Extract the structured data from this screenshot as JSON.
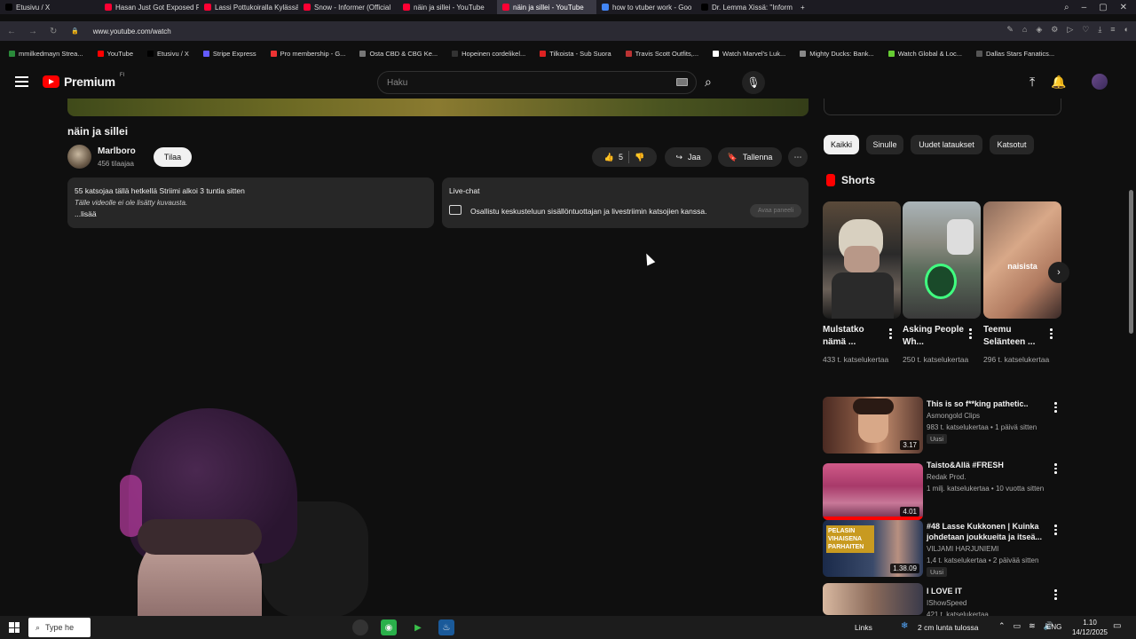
{
  "browser": {
    "tabs": [
      {
        "label": "Etusivu / X",
        "color": "#000000"
      },
      {
        "label": "Hasan Just Got Exposed Fr",
        "color": "#ff0033"
      },
      {
        "label": "Lassi Pottukoiralla Kylässä",
        "color": "#ff0033"
      },
      {
        "label": "Snow - Informer (Official",
        "color": "#ff0033"
      },
      {
        "label": "näin ja sillei - YouTube",
        "color": "#ff0033"
      },
      {
        "label": "näin ja sillei - YouTube",
        "color": "#ff0033",
        "active": true
      },
      {
        "label": "how to vtuber work - Goo",
        "color": "#4285f4"
      },
      {
        "label": "Dr. Lemma Xissä: \"Inform",
        "color": "#000000"
      }
    ],
    "url": "www.youtube.com/watch",
    "bookmarks": [
      {
        "label": "mmilkedmayn Strea...",
        "color": "#2a8a3a"
      },
      {
        "label": "YouTube",
        "color": "#ff0000"
      },
      {
        "label": "Etusivu / X",
        "color": "#000000"
      },
      {
        "label": "Stripe Express",
        "color": "#635bff"
      },
      {
        "label": "Pro membership - G...",
        "color": "#e33"
      },
      {
        "label": "Osta CBD & CBG Ke...",
        "color": "#777"
      },
      {
        "label": "Hopeinen cordelikel...",
        "color": "#333"
      },
      {
        "label": "Tilkoista - Sub Suora",
        "color": "#d22"
      },
      {
        "label": "Travis Scott Outfits,...",
        "color": "#b33"
      },
      {
        "label": "Watch Marvel's Luk...",
        "color": "#fff"
      },
      {
        "label": "Mighty Ducks: Bank...",
        "color": "#888"
      },
      {
        "label": "Watch Global & Loc...",
        "color": "#6c3"
      },
      {
        "label": "Dallas Stars Fanatics...",
        "color": "#555"
      }
    ]
  },
  "header": {
    "logo_text": "Premium",
    "region": "FI",
    "search_placeholder": "Haku"
  },
  "video": {
    "title": "näin ja sillei",
    "channel": "Marlboro",
    "subscribers": "456 tilaajaa",
    "subscribe_label": "Tilaa",
    "likes": "5",
    "share_label": "Jaa",
    "save_label": "Tallenna",
    "description": {
      "stats": "55 katsojaa tällä hetkellä  Striimi alkoi 3 tuntia sitten",
      "empty_note": "Tälle videolle ei ole lisätty kuvausta.",
      "more": "...lisää"
    },
    "live_chat": {
      "title": "Live-chat",
      "text": "Osallistu keskusteluun sisällöntuottajan ja livestriimin katsojien kanssa.",
      "open_label": "Avaa paneeli"
    }
  },
  "sidebar": {
    "chips": [
      "Kaikki",
      "Sinulle",
      "Uudet lataukset",
      "Katsotut"
    ],
    "shorts_heading": "Shorts",
    "shorts": [
      {
        "title": "Mulstatko nämä ...",
        "views": "433 t. katselukertaa"
      },
      {
        "title": "Asking People Wh...",
        "views": "250 t. katselukertaa"
      },
      {
        "title": "Teemu Selänteen ...",
        "views": "296 t. katselukertaa"
      }
    ],
    "short_overlay_text": "naisista",
    "recommendations": [
      {
        "title": "This is so f**king pathetic..",
        "channel": "Asmongold Clips",
        "meta": "983 t. katselukertaa • 1 päivä sitten",
        "badge": "Uusi",
        "duration": "3.17"
      },
      {
        "title": "Taisto&Allä #FRESH",
        "channel": "Redak Prod.",
        "meta": "1 milj. katselukertaa • 10 vuotta sitten",
        "badge": "",
        "duration": "4.01"
      },
      {
        "title": "#48 Lasse Kukkonen | Kuinka johdetaan joukkueita ja itseä...",
        "channel": "VILJAMI HARJUNIEMI",
        "meta": "1,4 t. katselukertaa • 2 päivää sitten",
        "badge": "Uusi",
        "duration": "1.38.09",
        "thumb_text": "PELASIN VIHAISENA PARHAITEN"
      },
      {
        "title": "I LOVE IT",
        "channel": "IShowSpeed",
        "meta": "421 t. katselukertaa",
        "badge": "",
        "duration": ""
      }
    ]
  },
  "taskbar": {
    "search_placeholder": "Type he",
    "links_label": "Links",
    "weather": "2 cm lunta tulossa",
    "lang": "ENG",
    "time": "1.10",
    "date": "14/12/2025"
  }
}
